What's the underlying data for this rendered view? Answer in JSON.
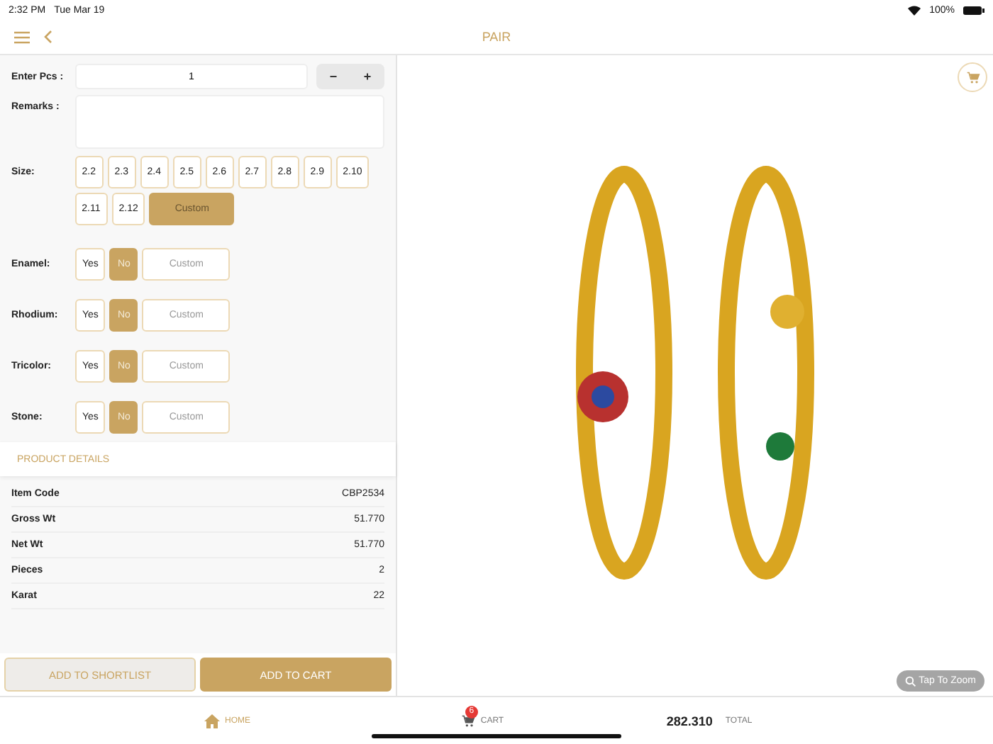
{
  "status_bar": {
    "time": "2:32 PM",
    "date": "Tue Mar 19",
    "battery": "100%"
  },
  "nav": {
    "title": "PAIR"
  },
  "pieces": {
    "label": "Enter Pcs :",
    "value": "1",
    "minus": "−",
    "plus": "+"
  },
  "remarks": {
    "label": "Remarks :"
  },
  "size": {
    "label": "Size:",
    "options": [
      {
        "label": "2.2",
        "selected": false
      },
      {
        "label": "2.3",
        "selected": false
      },
      {
        "label": "2.4",
        "selected": false
      },
      {
        "label": "2.5",
        "selected": false
      },
      {
        "label": "2.6",
        "selected": false
      },
      {
        "label": "2.7",
        "selected": false
      },
      {
        "label": "2.8",
        "selected": false
      },
      {
        "label": "2.9",
        "selected": false
      },
      {
        "label": "2.10",
        "selected": false
      },
      {
        "label": "2.11",
        "selected": false
      },
      {
        "label": "2.12",
        "selected": false
      },
      {
        "label": "Custom",
        "selected": true
      }
    ]
  },
  "options": [
    {
      "label": "Enamel:",
      "choices": [
        {
          "label": "Yes",
          "selected": false
        },
        {
          "label": "No",
          "selected": true
        }
      ],
      "custom_placeholder": "Custom"
    },
    {
      "label": "Rhodium:",
      "choices": [
        {
          "label": "Yes",
          "selected": false
        },
        {
          "label": "No",
          "selected": true
        }
      ],
      "custom_placeholder": "Custom"
    },
    {
      "label": "Tricolor:",
      "choices": [
        {
          "label": "Yes",
          "selected": false
        },
        {
          "label": "No",
          "selected": true
        }
      ],
      "custom_placeholder": "Custom"
    },
    {
      "label": "Stone:",
      "choices": [
        {
          "label": "Yes",
          "selected": false
        },
        {
          "label": "No",
          "selected": true
        }
      ],
      "custom_placeholder": "Custom"
    }
  ],
  "product_details": {
    "title": "PRODUCT DETAILS",
    "rows": [
      {
        "label": "Item Code",
        "value": "CBP2534"
      },
      {
        "label": "Gross Wt",
        "value": "51.770"
      },
      {
        "label": "Net Wt",
        "value": "51.770"
      },
      {
        "label": "Pieces",
        "value": "2"
      },
      {
        "label": "Karat",
        "value": "22"
      }
    ]
  },
  "actions": {
    "shortlist": "ADD TO SHORTLIST",
    "cart": "ADD TO CART"
  },
  "image": {
    "zoom": "Tap To Zoom"
  },
  "tab_bar": {
    "home": "HOME",
    "cart": "CART",
    "cart_count": "6",
    "total_value": "282.310",
    "total_label": "TOTAL"
  }
}
